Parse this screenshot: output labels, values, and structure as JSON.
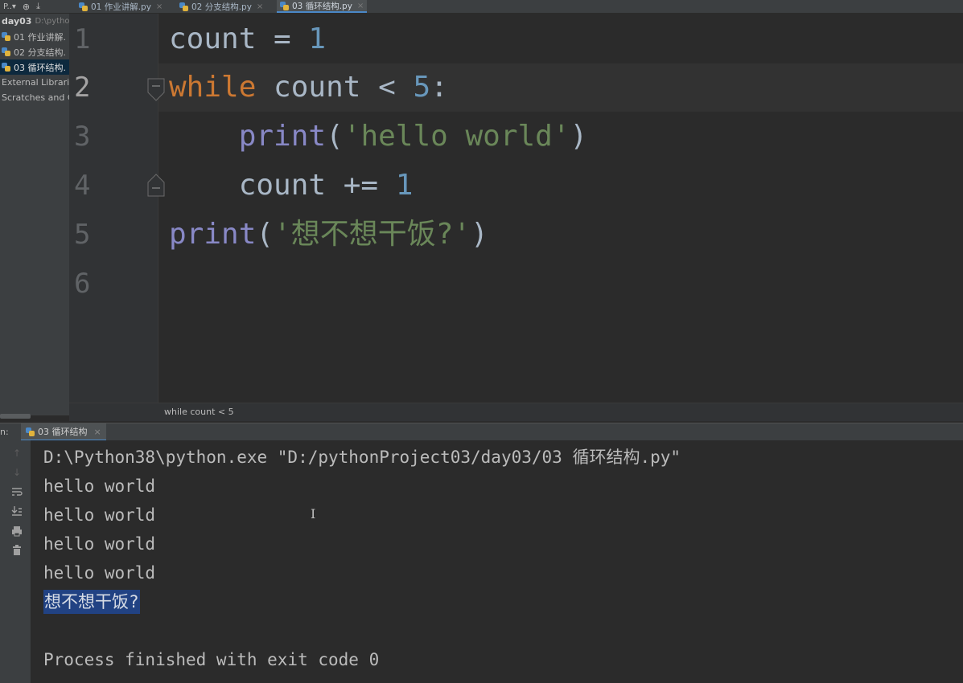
{
  "project_header": {
    "label": "P..▾"
  },
  "tabs": [
    {
      "label": "01 作业讲解.py",
      "close": "×"
    },
    {
      "label": "02 分支结构.py",
      "close": "×"
    },
    {
      "label": "03 循环结构.py",
      "close": "×"
    }
  ],
  "project_tree": {
    "root_name": "day03",
    "root_path": "D:\\pytho",
    "items": [
      "01 作业讲解.",
      "02 分支结构.",
      "03 循环结构."
    ],
    "external": "External Librari",
    "scratches": "Scratches and C"
  },
  "editor": {
    "line_numbers": [
      "1",
      "2",
      "3",
      "4",
      "5",
      "6"
    ],
    "current_line": 2,
    "lines": {
      "l1": {
        "var": "count",
        "op": " = ",
        "num": "1"
      },
      "l2": {
        "kw": "while",
        "var": " count ",
        "op": "< ",
        "num": "5",
        "colon": ":"
      },
      "l3": {
        "indent": "    ",
        "fn": "print",
        "open": "(",
        "str": "'hello world'",
        "close": ")"
      },
      "l4": {
        "indent": "    ",
        "var": "count ",
        "op": "+= ",
        "num": "1"
      },
      "l5": {
        "fn": "print",
        "open": "(",
        "str": "'想不想干饭?'",
        "close": ")"
      }
    }
  },
  "breadcrumb": "while count < 5",
  "run_panel": {
    "label": "n:",
    "tab_label": "03 循环结构",
    "tab_close": "×",
    "output": [
      "D:\\Python38\\python.exe \"D:/pythonProject03/day03/03 循环结构.py\"",
      "hello world",
      "hello world",
      "hello world",
      "hello world",
      "想不想干饭?",
      "",
      "Process finished with exit code 0"
    ]
  },
  "colors": {
    "keyword": "#cc7832",
    "number": "#6897bb",
    "builtin": "#8888c6",
    "string": "#6a8759",
    "selection": "#214283"
  }
}
